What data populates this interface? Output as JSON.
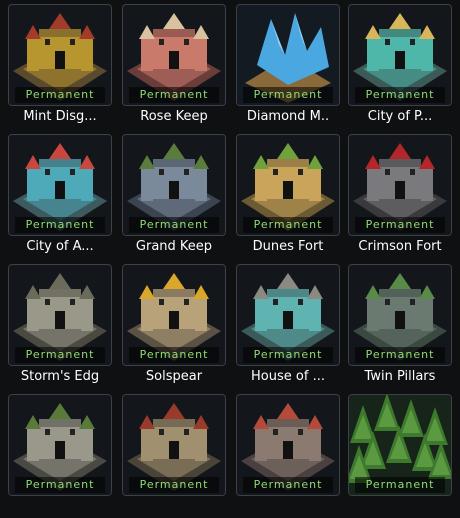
{
  "badge_color": "#8fdc72",
  "tiles": [
    {
      "name": "Mint Disg...",
      "badge": "Permanent",
      "icon": "mint-castle-icon",
      "palette": [
        "#5a4a2e",
        "#b8962f",
        "#a33b2b"
      ]
    },
    {
      "name": "Rose Keep",
      "badge": "Permanent",
      "icon": "rose-keep-icon",
      "palette": [
        "#6b3d3a",
        "#c97a6b",
        "#d9c2a0"
      ]
    },
    {
      "name": "Diamond M..",
      "badge": "Permanent",
      "icon": "diamond-mine-icon",
      "palette": [
        "#27466b",
        "#4aa7e0",
        "#8a6a3b"
      ]
    },
    {
      "name": "City of P...",
      "badge": "Permanent",
      "icon": "city-of-p-icon",
      "palette": [
        "#3c5a58",
        "#4fb7a9",
        "#d8b45a"
      ]
    },
    {
      "name": "City of A...",
      "badge": "Permanent",
      "icon": "city-of-a-icon",
      "palette": [
        "#3d5a5e",
        "#4ea9b8",
        "#c9473e"
      ]
    },
    {
      "name": "Grand Keep",
      "badge": "Permanent",
      "icon": "grand-keep-icon",
      "palette": [
        "#3b4450",
        "#7b8a9a",
        "#5a7d3b"
      ]
    },
    {
      "name": "Dunes Fort",
      "badge": "Permanent",
      "icon": "dunes-fort-icon",
      "palette": [
        "#6b5a33",
        "#c9a45a",
        "#6fa23b"
      ]
    },
    {
      "name": "Crimson Fort",
      "badge": "Permanent",
      "icon": "crimson-fort-icon",
      "palette": [
        "#3a3a3c",
        "#7a7a7e",
        "#b3262a"
      ]
    },
    {
      "name": "Storm's Edg",
      "badge": "Permanent",
      "icon": "storms-edge-icon",
      "palette": [
        "#4a4a40",
        "#9a9888",
        "#6b6b5c"
      ]
    },
    {
      "name": "Solspear",
      "badge": "Permanent",
      "icon": "solspear-icon",
      "palette": [
        "#5b5245",
        "#b8a27a",
        "#d9a82a"
      ]
    },
    {
      "name": "House of ...",
      "badge": "Permanent",
      "icon": "house-of-icon",
      "palette": [
        "#3b5a5a",
        "#5fb3b0",
        "#8a8a80"
      ]
    },
    {
      "name": "Twin Pillars",
      "badge": "Permanent",
      "icon": "twin-pillars-icon",
      "palette": [
        "#3a4a40",
        "#6a7a70",
        "#5a8a4a"
      ]
    },
    {
      "name": "",
      "badge": "Permanent",
      "icon": "stone-castle-icon",
      "palette": [
        "#4a4a44",
        "#9a988a",
        "#5a7a3a"
      ]
    },
    {
      "name": "",
      "badge": "Permanent",
      "icon": "manor-icon",
      "palette": [
        "#4a4438",
        "#a09070",
        "#9a3a2a"
      ]
    },
    {
      "name": "",
      "badge": "Permanent",
      "icon": "red-tower-castle-icon",
      "palette": [
        "#4a4040",
        "#8a7a70",
        "#b34a3a"
      ]
    },
    {
      "name": "",
      "badge": "Permanent",
      "icon": "pine-forest-icon",
      "palette": [
        "#1f3a1c",
        "#3e7a2e",
        "#6aa84a"
      ]
    }
  ]
}
